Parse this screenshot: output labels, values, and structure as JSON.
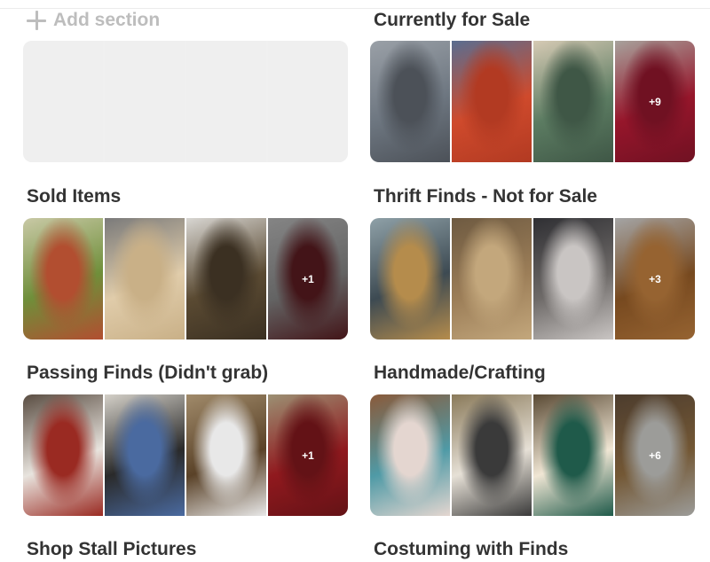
{
  "add_section": {
    "label": "Add section",
    "icon": "plus-icon"
  },
  "sections": [
    {
      "title": "",
      "empty": true,
      "tiles": []
    },
    {
      "title": "Currently for Sale",
      "tiles": [
        {
          "colors": [
            "#6d7680",
            "#4c5158",
            "#9aa0a7"
          ],
          "badge": ""
        },
        {
          "colors": [
            "#cf4a2c",
            "#b23a22",
            "#5a6e90"
          ],
          "badge": ""
        },
        {
          "colors": [
            "#5c7c62",
            "#3f5746",
            "#d6cab4"
          ],
          "badge": ""
        },
        {
          "colors": [
            "#d01f3c",
            "#9c1830",
            "#e8e0d8"
          ],
          "badge": "+9"
        }
      ]
    },
    {
      "title": "Sold Items",
      "tiles": [
        {
          "colors": [
            "#6f8f3a",
            "#b24e30",
            "#c9c9a6"
          ],
          "badge": ""
        },
        {
          "colors": [
            "#e0ccaa",
            "#c9b087",
            "#7a7a7a"
          ],
          "badge": ""
        },
        {
          "colors": [
            "#5a4a32",
            "#3b3022",
            "#d8d6d2"
          ],
          "badge": ""
        },
        {
          "colors": [
            "#8a8a8a",
            "#5d1d22",
            "#b8b8b8"
          ],
          "badge": "+1"
        }
      ]
    },
    {
      "title": "Thrift Finds - Not for Sale",
      "tiles": [
        {
          "colors": [
            "#3d4a52",
            "#b58c4c",
            "#8fa1a8"
          ],
          "badge": ""
        },
        {
          "colors": [
            "#9c7e58",
            "#c3a77c",
            "#6e5a41"
          ],
          "badge": ""
        },
        {
          "colors": [
            "#6e6a68",
            "#c9c5c3",
            "#2f2f33"
          ],
          "badge": ""
        },
        {
          "colors": [
            "#a5662c",
            "#d08a45",
            "#e4e4e4"
          ],
          "badge": "+3"
        }
      ]
    },
    {
      "title": "Passing Finds (Didn't grab)",
      "tiles": [
        {
          "colors": [
            "#e8e4de",
            "#9a2a22",
            "#5a4d42"
          ],
          "badge": ""
        },
        {
          "colors": [
            "#2a2a2a",
            "#4a6aa0",
            "#d4d0c8"
          ],
          "badge": ""
        },
        {
          "colors": [
            "#5a4228",
            "#e8e8e8",
            "#a08a6a"
          ],
          "badge": ""
        },
        {
          "colors": [
            "#c8232a",
            "#8a1a1f",
            "#d8c8a0"
          ],
          "badge": "+1"
        }
      ]
    },
    {
      "title": "Handmade/Crafting",
      "tiles": [
        {
          "colors": [
            "#4f9aa6",
            "#e4d6d0",
            "#8a5a3a"
          ],
          "badge": ""
        },
        {
          "colors": [
            "#e6e0d6",
            "#3a3a3a",
            "#8a7a5a"
          ],
          "badge": ""
        },
        {
          "colors": [
            "#f0e6d4",
            "#1f5a4a",
            "#5a4a34"
          ],
          "badge": ""
        },
        {
          "colors": [
            "#a07a4a",
            "#d8d8d4",
            "#6a5440"
          ],
          "badge": "+6"
        }
      ]
    },
    {
      "title": "Shop Stall Pictures",
      "tiles": []
    },
    {
      "title": "Costuming with Finds",
      "tiles": []
    }
  ]
}
